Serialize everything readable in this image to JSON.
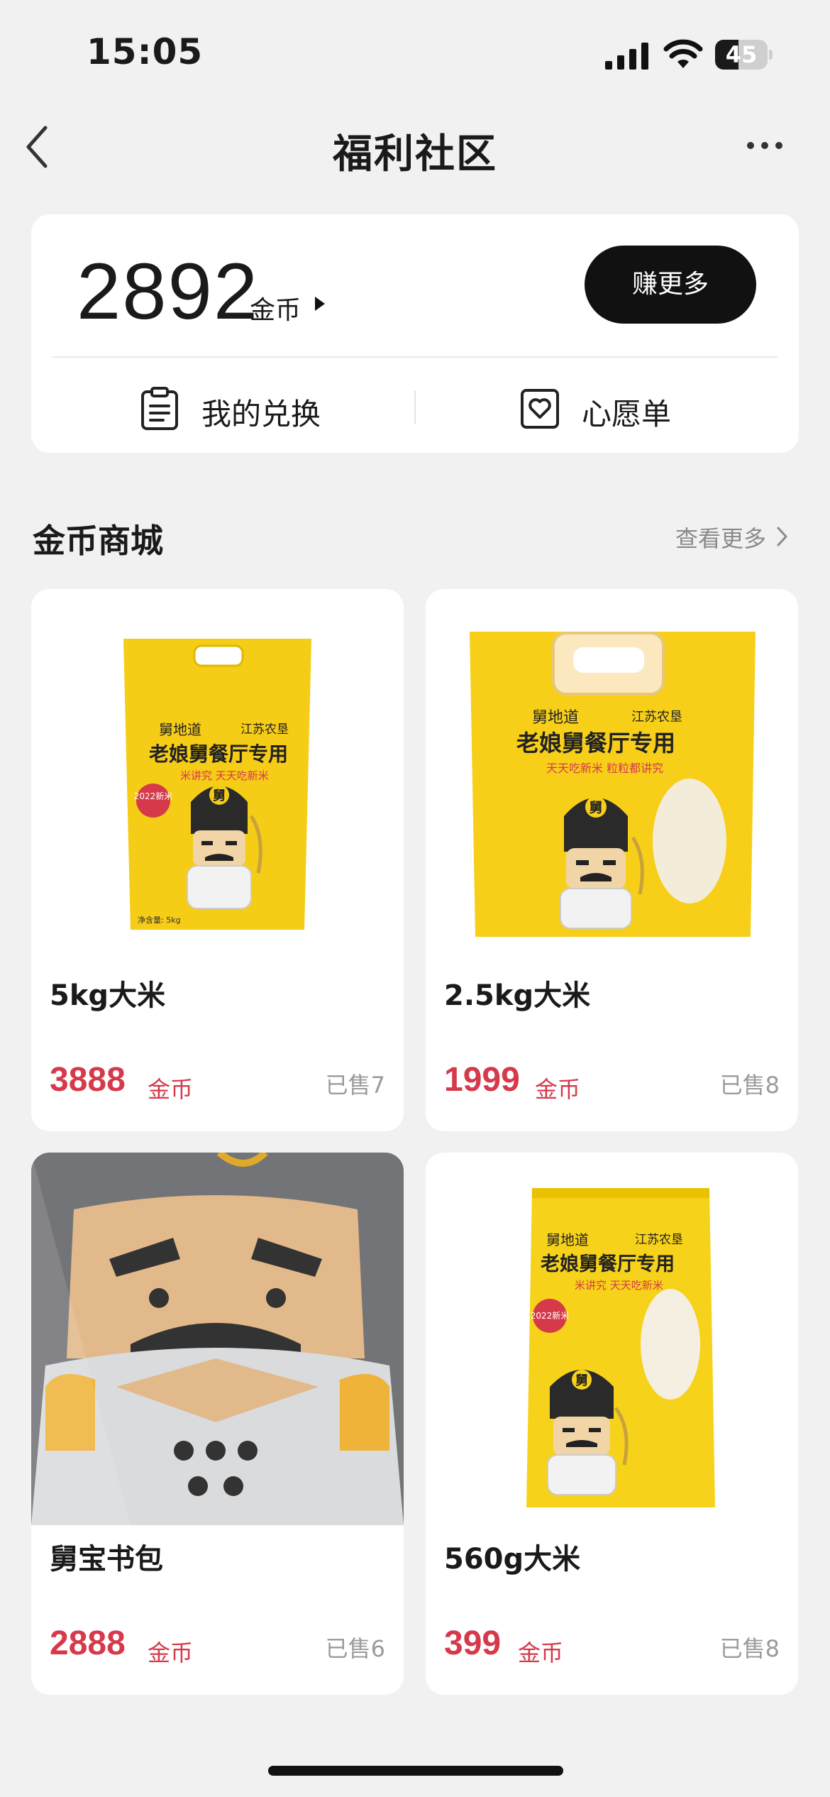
{
  "status_bar": {
    "time": "15:05",
    "battery": "45",
    "battery_level": 0.45
  },
  "nav": {
    "title": "福利社区"
  },
  "coins": {
    "balance": "2892",
    "unit": "金币",
    "earn_button": "赚更多",
    "my_exchange": "我的兑换",
    "wishlist": "心愿单"
  },
  "store": {
    "title": "金币商城",
    "see_more": "查看更多",
    "products": [
      {
        "name": "5kg大米",
        "price": "3888",
        "unit": "金币",
        "sold": "已售7"
      },
      {
        "name": "2.5kg大米",
        "price": "1999",
        "unit": "金币",
        "sold": "已售8"
      },
      {
        "name": "舅宝书包",
        "price": "2888",
        "unit": "金币",
        "sold": "已售6"
      },
      {
        "name": "560g大米",
        "price": "399",
        "unit": "金币",
        "sold": "已售8"
      }
    ],
    "bag_text": {
      "brand": "舅地道",
      "partner": "江苏农垦",
      "headline": "老娘舅餐厅专用",
      "slogan_a": "米讲究 天天吃新米",
      "slogan_b": "天天吃新米 粒粒都讲究",
      "badge": "2022新米",
      "mascot_char": "舅",
      "net_weight": "净含量: 5kg"
    }
  },
  "colors": {
    "accent_red": "#d6394a",
    "bag_yellow": "#f5cc16",
    "dark": "#111111"
  }
}
